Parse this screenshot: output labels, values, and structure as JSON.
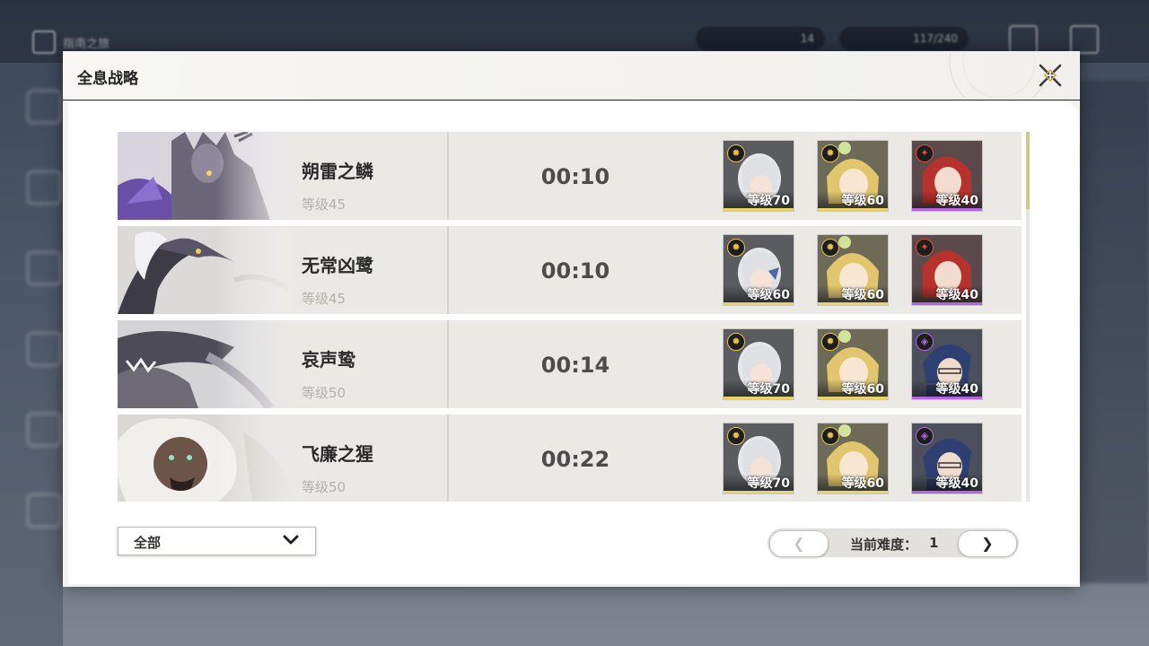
{
  "background": {
    "title": "指南之旅",
    "currency_1": "14",
    "currency_2": "117/240"
  },
  "panel": {
    "title": "全息战略"
  },
  "bosses": [
    {
      "name": "朔雷之鳞",
      "level": "等级45",
      "time": "00:10",
      "team": [
        {
          "level": "等级70",
          "rarity": "gold",
          "element": "spectro-icon"
        },
        {
          "level": "等级60",
          "rarity": "gold",
          "element": "spectro-icon"
        },
        {
          "level": "等级40",
          "rarity": "purple",
          "element": "fusion-icon"
        }
      ]
    },
    {
      "name": "无常凶鹭",
      "level": "等级45",
      "time": "00:10",
      "team": [
        {
          "level": "等级60",
          "rarity": "gold",
          "element": "spectro-icon"
        },
        {
          "level": "等级60",
          "rarity": "gold",
          "element": "spectro-icon"
        },
        {
          "level": "等级40",
          "rarity": "purple",
          "element": "fusion-icon"
        }
      ]
    },
    {
      "name": "哀声鸷",
      "level": "等级50",
      "time": "00:14",
      "team": [
        {
          "level": "等级70",
          "rarity": "gold",
          "element": "spectro-icon"
        },
        {
          "level": "等级60",
          "rarity": "gold",
          "element": "spectro-icon"
        },
        {
          "level": "等级40",
          "rarity": "purple",
          "element": "havoc-icon"
        }
      ]
    },
    {
      "name": "飞廉之猩",
      "level": "等级50",
      "time": "00:22",
      "team": [
        {
          "level": "等级70",
          "rarity": "gold",
          "element": "spectro-icon"
        },
        {
          "level": "等级60",
          "rarity": "gold",
          "element": "spectro-icon"
        },
        {
          "level": "等级40",
          "rarity": "purple",
          "element": "havoc-icon"
        }
      ]
    }
  ],
  "filter": {
    "selected": "全部"
  },
  "pager": {
    "prev": "❮",
    "next": "❯",
    "label": "当前难度：",
    "value": "1"
  },
  "colors": {
    "gold_rarity": "#e9d46a",
    "purple_rarity": "#b565e0",
    "accent": "#d9c583"
  }
}
